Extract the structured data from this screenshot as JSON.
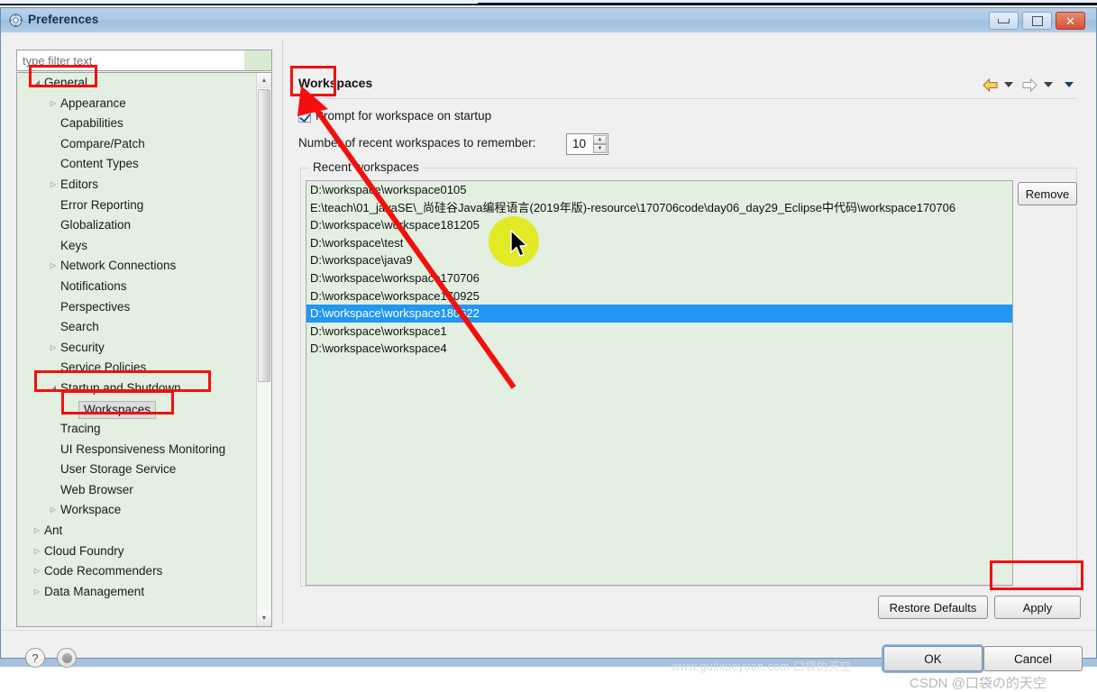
{
  "window": {
    "title": "Preferences",
    "icon": "preferences-gear-icon",
    "controls": {
      "minimize": "Minimize",
      "maximize": "Maximize",
      "close": "Close"
    }
  },
  "filter": {
    "placeholder": "type filter text",
    "value": ""
  },
  "tree": {
    "items": [
      {
        "label": "General",
        "indent": 0,
        "twisty": "expanded",
        "selected": false
      },
      {
        "label": "Appearance",
        "indent": 1,
        "twisty": "collapsed",
        "selected": false
      },
      {
        "label": "Capabilities",
        "indent": 1,
        "twisty": "none",
        "selected": false
      },
      {
        "label": "Compare/Patch",
        "indent": 1,
        "twisty": "none",
        "selected": false
      },
      {
        "label": "Content Types",
        "indent": 1,
        "twisty": "none",
        "selected": false
      },
      {
        "label": "Editors",
        "indent": 1,
        "twisty": "collapsed",
        "selected": false
      },
      {
        "label": "Error Reporting",
        "indent": 1,
        "twisty": "none",
        "selected": false
      },
      {
        "label": "Globalization",
        "indent": 1,
        "twisty": "none",
        "selected": false
      },
      {
        "label": "Keys",
        "indent": 1,
        "twisty": "none",
        "selected": false
      },
      {
        "label": "Network Connections",
        "indent": 1,
        "twisty": "collapsed",
        "selected": false
      },
      {
        "label": "Notifications",
        "indent": 1,
        "twisty": "none",
        "selected": false
      },
      {
        "label": "Perspectives",
        "indent": 1,
        "twisty": "none",
        "selected": false
      },
      {
        "label": "Search",
        "indent": 1,
        "twisty": "none",
        "selected": false
      },
      {
        "label": "Security",
        "indent": 1,
        "twisty": "collapsed",
        "selected": false
      },
      {
        "label": "Service Policies",
        "indent": 1,
        "twisty": "none",
        "selected": false
      },
      {
        "label": "Startup and Shutdown",
        "indent": 1,
        "twisty": "expanded",
        "selected": false
      },
      {
        "label": "Workspaces",
        "indent": 2,
        "twisty": "none",
        "selected": true
      },
      {
        "label": "Tracing",
        "indent": 1,
        "twisty": "none",
        "selected": false
      },
      {
        "label": "UI Responsiveness Monitoring",
        "indent": 1,
        "twisty": "none",
        "selected": false
      },
      {
        "label": "User Storage Service",
        "indent": 1,
        "twisty": "none",
        "selected": false
      },
      {
        "label": "Web Browser",
        "indent": 1,
        "twisty": "none",
        "selected": false
      },
      {
        "label": "Workspace",
        "indent": 1,
        "twisty": "collapsed",
        "selected": false
      },
      {
        "label": "Ant",
        "indent": 0,
        "twisty": "collapsed",
        "selected": false
      },
      {
        "label": "Cloud Foundry",
        "indent": 0,
        "twisty": "collapsed",
        "selected": false
      },
      {
        "label": "Code Recommenders",
        "indent": 0,
        "twisty": "collapsed",
        "selected": false
      },
      {
        "label": "Data Management",
        "indent": 0,
        "twisty": "collapsed",
        "selected": false
      }
    ]
  },
  "page": {
    "title": "Workspaces",
    "prompt_checkbox": {
      "label": "Prompt for workspace on startup",
      "checked": true
    },
    "recent_count": {
      "label": "Number of recent workspaces to remember:",
      "value": "10"
    },
    "group_label": "Recent workspaces",
    "remove_button": "Remove",
    "restore_defaults_button": "Restore Defaults",
    "apply_button": "Apply",
    "workspaces": [
      {
        "path": "D:\\workspace\\workspace0105",
        "selected": false
      },
      {
        "path": "E:\\teach\\01_javaSE\\_尚硅谷Java编程语言(2019年版)-resource\\170706code\\day06_day29_Eclipse中代码\\workspace170706",
        "selected": false
      },
      {
        "path": "D:\\workspace\\workspace181205",
        "selected": false
      },
      {
        "path": "D:\\workspace\\test",
        "selected": false
      },
      {
        "path": "D:\\workspace\\java9",
        "selected": false
      },
      {
        "path": "D:\\workspace\\workspace170706",
        "selected": false
      },
      {
        "path": "D:\\workspace\\workspace170925",
        "selected": false
      },
      {
        "path": "D:\\workspace\\workspace180622",
        "selected": true
      },
      {
        "path": "D:\\workspace\\workspace1",
        "selected": false
      },
      {
        "path": "D:\\workspace\\workspace4",
        "selected": false
      }
    ]
  },
  "navigation": {
    "back": "back-arrow-icon",
    "back_menu": "back-dropdown-icon",
    "forward": "forward-arrow-icon",
    "forward_menu": "forward-dropdown-icon",
    "more": "view-menu-icon"
  },
  "footer": {
    "help": "?",
    "pin": "pin-icon",
    "ok_button": "OK",
    "cancel_button": "Cancel"
  },
  "watermarks": {
    "site": "www.gulixueyuan.com 口袋的天空",
    "csdn": "CSDN @口袋の的天空"
  },
  "annotations": {
    "accent_color": "#f40f0f",
    "highlight_color": "#e2e817",
    "boxes": [
      "General",
      "Startup and Shutdown",
      "Workspaces",
      "Prompt for workspace on startup",
      "Apply"
    ]
  }
}
